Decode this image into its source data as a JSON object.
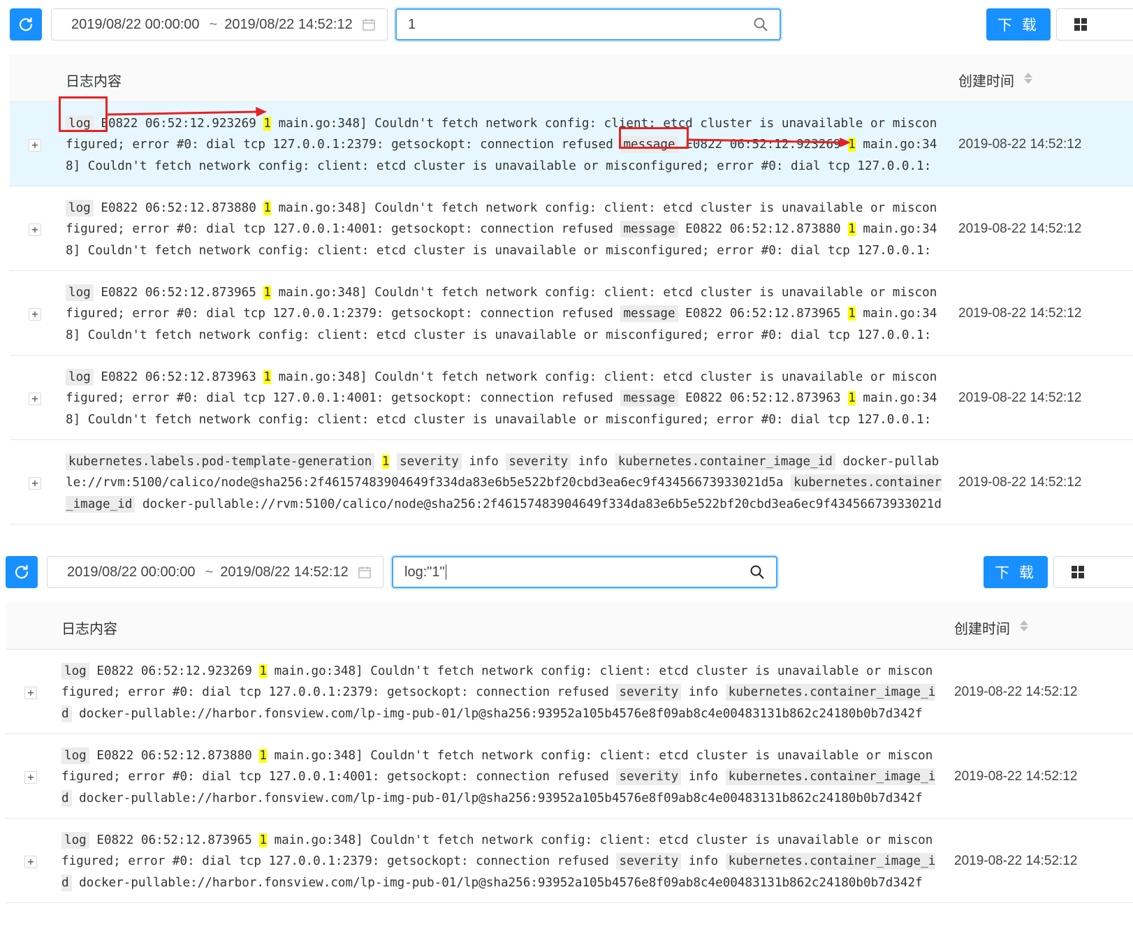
{
  "panel_top": {
    "date_start": "2019/08/22 00:00:00",
    "date_sep": "~",
    "date_end": "2019/08/22 14:52:12",
    "query": "1",
    "download_label": "下 载",
    "col_content": "日志内容",
    "col_time": "创建时间",
    "rows": [
      {
        "content": [
          {
            "t": "k",
            "v": "log"
          },
          {
            "t": "s",
            "v": " E0822 06:52:12.923269 "
          },
          {
            "t": "h",
            "v": "1"
          },
          {
            "t": "s",
            "v": " main.go:348] Couldn't fetch network config: client: etcd cluster is unavailable or misconfigured; error #0: dial tcp 127.0.0.1:2379: getsockopt: connection refused "
          },
          {
            "t": "k",
            "v": "message"
          },
          {
            "t": "s",
            "v": " E0822 06:52:12.923269 "
          },
          {
            "t": "h",
            "v": "1"
          },
          {
            "t": "s",
            "v": " main.go:348] Couldn't fetch network config: client: etcd cluster is unavailable or misconfigured; error #0: dial tcp 127.0.0.1:"
          }
        ],
        "time": "2019-08-22 14:52:12"
      },
      {
        "content": [
          {
            "t": "k",
            "v": "log"
          },
          {
            "t": "s",
            "v": " E0822 06:52:12.873880 "
          },
          {
            "t": "h",
            "v": "1"
          },
          {
            "t": "s",
            "v": " main.go:348] Couldn't fetch network config: client: etcd cluster is unavailable or misconfigured; error #0: dial tcp 127.0.0.1:4001: getsockopt: connection refused "
          },
          {
            "t": "k",
            "v": "message"
          },
          {
            "t": "s",
            "v": " E0822 06:52:12.873880 "
          },
          {
            "t": "h",
            "v": "1"
          },
          {
            "t": "s",
            "v": " main.go:348] Couldn't fetch network config: client: etcd cluster is unavailable or misconfigured; error #0: dial tcp 127.0.0.1:"
          }
        ],
        "time": "2019-08-22 14:52:12"
      },
      {
        "content": [
          {
            "t": "k",
            "v": "log"
          },
          {
            "t": "s",
            "v": " E0822 06:52:12.873965 "
          },
          {
            "t": "h",
            "v": "1"
          },
          {
            "t": "s",
            "v": " main.go:348] Couldn't fetch network config: client: etcd cluster is unavailable or misconfigured; error #0: dial tcp 127.0.0.1:2379: getsockopt: connection refused "
          },
          {
            "t": "k",
            "v": "message"
          },
          {
            "t": "s",
            "v": " E0822 06:52:12.873965 "
          },
          {
            "t": "h",
            "v": "1"
          },
          {
            "t": "s",
            "v": " main.go:348] Couldn't fetch network config: client: etcd cluster is unavailable or misconfigured; error #0: dial tcp 127.0.0.1:"
          }
        ],
        "time": "2019-08-22 14:52:12"
      },
      {
        "content": [
          {
            "t": "k",
            "v": "log"
          },
          {
            "t": "s",
            "v": " E0822 06:52:12.873963 "
          },
          {
            "t": "h",
            "v": "1"
          },
          {
            "t": "s",
            "v": " main.go:348] Couldn't fetch network config: client: etcd cluster is unavailable or misconfigured; error #0: dial tcp 127.0.0.1:4001: getsockopt: connection refused "
          },
          {
            "t": "k",
            "v": "message"
          },
          {
            "t": "s",
            "v": " E0822 06:52:12.873963 "
          },
          {
            "t": "h",
            "v": "1"
          },
          {
            "t": "s",
            "v": " main.go:348] Couldn't fetch network config: client: etcd cluster is unavailable or misconfigured; error #0: dial tcp 127.0.0.1:"
          }
        ],
        "time": "2019-08-22 14:52:12"
      },
      {
        "content": [
          {
            "t": "k",
            "v": "kubernetes.labels.pod-template-generation"
          },
          {
            "t": "s",
            "v": " "
          },
          {
            "t": "h",
            "v": "1"
          },
          {
            "t": "s",
            "v": " "
          },
          {
            "t": "k",
            "v": "severity"
          },
          {
            "t": "s",
            "v": " info "
          },
          {
            "t": "k",
            "v": "severity"
          },
          {
            "t": "s",
            "v": " info "
          },
          {
            "t": "k",
            "v": "kubernetes.container_image_id"
          },
          {
            "t": "s",
            "v": " docker-pullable://rvm:5100/calico/node@sha256:2f46157483904649f334da83e6b5e522bf20cbd3ea6ec9f43456673933021d5a "
          },
          {
            "t": "k",
            "v": "kubernetes.container_image_id"
          },
          {
            "t": "s",
            "v": " docker-pullable://rvm:5100/calico/node@sha256:2f46157483904649f334da83e6b5e522bf20cbd3ea6ec9f43456673933021d"
          }
        ],
        "time": "2019-08-22 14:52:12"
      }
    ]
  },
  "panel_bottom": {
    "date_start": "2019/08/22 00:00:00",
    "date_sep": "~",
    "date_end": "2019/08/22 14:52:12",
    "query": "log:\"1\"",
    "download_label": "下 载",
    "col_content": "日志内容",
    "col_time": "创建时间",
    "rows": [
      {
        "content": [
          {
            "t": "k",
            "v": "log"
          },
          {
            "t": "s",
            "v": " E0822 06:52:12.923269 "
          },
          {
            "t": "h",
            "v": "1"
          },
          {
            "t": "s",
            "v": " main.go:348] Couldn't fetch network config: client: etcd cluster is unavailable or misconfigured; error #0: dial tcp 127.0.0.1:2379: getsockopt: connection refused "
          },
          {
            "t": "k",
            "v": "severity"
          },
          {
            "t": "s",
            "v": " info "
          },
          {
            "t": "k",
            "v": "kubernetes.container_image_id"
          },
          {
            "t": "s",
            "v": " docker-pullable://harbor.fonsview.com/lp-img-pub-01/lp@sha256:93952a105b4576e8f09ab8c4e00483131b862c24180b0b7d342f"
          }
        ],
        "time": "2019-08-22 14:52:12"
      },
      {
        "content": [
          {
            "t": "k",
            "v": "log"
          },
          {
            "t": "s",
            "v": " E0822 06:52:12.873880 "
          },
          {
            "t": "h",
            "v": "1"
          },
          {
            "t": "s",
            "v": " main.go:348] Couldn't fetch network config: client: etcd cluster is unavailable or misconfigured; error #0: dial tcp 127.0.0.1:4001: getsockopt: connection refused "
          },
          {
            "t": "k",
            "v": "severity"
          },
          {
            "t": "s",
            "v": " info "
          },
          {
            "t": "k",
            "v": "kubernetes.container_image_id"
          },
          {
            "t": "s",
            "v": " docker-pullable://harbor.fonsview.com/lp-img-pub-01/lp@sha256:93952a105b4576e8f09ab8c4e00483131b862c24180b0b7d342f"
          }
        ],
        "time": "2019-08-22 14:52:12"
      },
      {
        "content": [
          {
            "t": "k",
            "v": "log"
          },
          {
            "t": "s",
            "v": " E0822 06:52:12.873965 "
          },
          {
            "t": "h",
            "v": "1"
          },
          {
            "t": "s",
            "v": " main.go:348] Couldn't fetch network config: client: etcd cluster is unavailable or misconfigured; error #0: dial tcp 127.0.0.1:2379: getsockopt: connection refused "
          },
          {
            "t": "k",
            "v": "severity"
          },
          {
            "t": "s",
            "v": " info "
          },
          {
            "t": "k",
            "v": "kubernetes.container_image_id"
          },
          {
            "t": "s",
            "v": " docker-pullable://harbor.fonsview.com/lp-img-pub-01/lp@sha256:93952a105b4576e8f09ab8c4e00483131b862c24180b0b7d342f"
          }
        ],
        "time": "2019-08-22 14:52:12"
      }
    ]
  },
  "colors": {
    "primary": "#1890ff",
    "row_active": "#e6f7ff",
    "highlight": "#ffff00",
    "annotation": "#e82222"
  },
  "icons": [
    "reload-icon",
    "calendar-icon",
    "search-icon",
    "appstore-icon",
    "sort-icon"
  ]
}
